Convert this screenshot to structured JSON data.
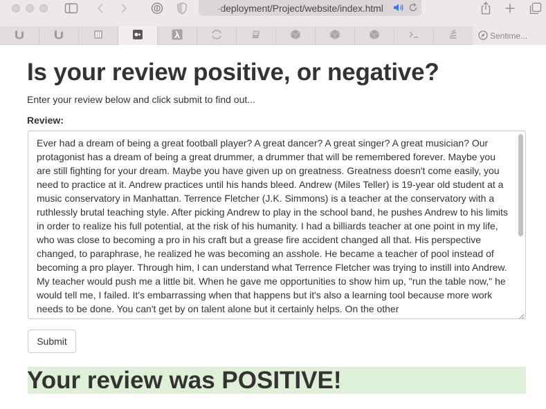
{
  "browser": {
    "url": "-deployment/Project/website/index.html",
    "tabs": [
      {
        "icon": "u-logo-icon"
      },
      {
        "icon": "u-logo-icon"
      },
      {
        "icon": "building-icon"
      },
      {
        "icon": "camera-icon",
        "active": true
      },
      {
        "icon": "lambda-icon"
      },
      {
        "icon": "loading-icon"
      },
      {
        "icon": "book-icon"
      },
      {
        "icon": "cube-icon"
      },
      {
        "icon": "cube-icon"
      },
      {
        "icon": "cube-icon"
      },
      {
        "icon": "terminal-icon"
      },
      {
        "icon": "stack-icon"
      }
    ],
    "last_tab_label": "Sentime..."
  },
  "page": {
    "title": "Is your review positive, or negative?",
    "intro": "Enter your review below and click submit to find out...",
    "review_label": "Review:",
    "review_text": "Ever had a dream of being a great football player? A great dancer? A great singer? A great musician? Our protagonist has a dream of being a great drummer, a drummer that will be remembered forever. Maybe you are still fighting for your dream. Maybe you have given up on greatness. Greatness doesn't come easily, you need to practice at it. Andrew practices until his hands bleed. Andrew (Miles Teller) is 19-year old student at a music conservatory in Manhattan. Terrence Fletcher (J.K. Simmons) is a teacher at the conservatory with a ruthlessly brutal teaching style. After picking Andrew to play in the school band, he pushes Andrew to his limits in order to realize his full potential, at the risk of his humanity. I had a billiards teacher at one point in my life, who was close to becoming a pro in his craft but a grease fire accident changed all that. His perspective changed, to paraphrase, he realized he was becoming an asshole. He became a teacher of pool instead of becoming a pro player. Through him, I can understand what Terrence Fletcher was trying to instill into Andrew. My teacher would push me a little bit. When he gave me opportunities to show him up, \"run the table now,\" he would tell me, I failed. It's embarrassing when that happens but it's also a learning tool because more work needs to be done. You can't get by on talent alone but it certainly helps. On the other",
    "submit_label": "Submit",
    "result": "Your review was POSITIVE!"
  },
  "colors": {
    "result_background": "#dff0d8",
    "text": "#333333"
  }
}
